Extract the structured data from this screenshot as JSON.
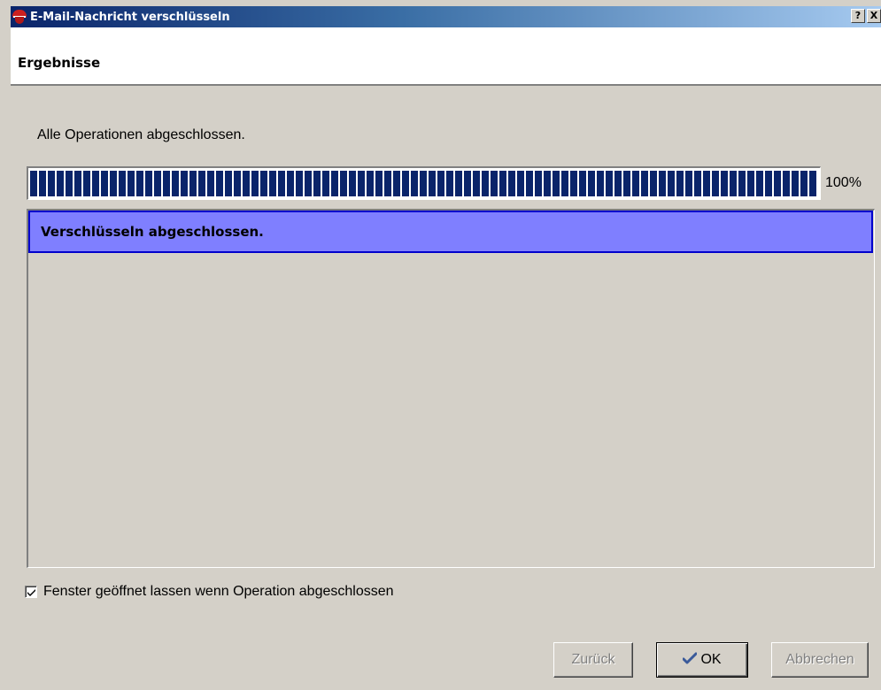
{
  "window": {
    "title": "E-Mail-Nachricht verschlüsseln",
    "help_button": "?",
    "close_button": "X"
  },
  "header": {
    "title": "Ergebnisse"
  },
  "status": {
    "text": "Alle Operationen abgeschlossen."
  },
  "progress": {
    "percent": 100,
    "label": "100%"
  },
  "results": {
    "items": [
      {
        "text": "Verschlüsseln abgeschlossen.",
        "selected": true
      }
    ]
  },
  "options": {
    "keep_open_label": "Fenster geöffnet lassen wenn Operation abgeschlossen",
    "keep_open_checked": true
  },
  "buttons": {
    "back_label": "Zurück",
    "back_enabled": false,
    "ok_label": "OK",
    "ok_icon": "checkmark-icon",
    "cancel_label": "Abbrechen",
    "cancel_enabled": false
  },
  "colors": {
    "titlebar_start": "#0a246a",
    "titlebar_end": "#a6caf0",
    "progress_fill": "#0a246a",
    "selection_bg": "#7f7fff",
    "selection_border": "#0000cc",
    "dialog_bg": "#d4d0c8"
  }
}
